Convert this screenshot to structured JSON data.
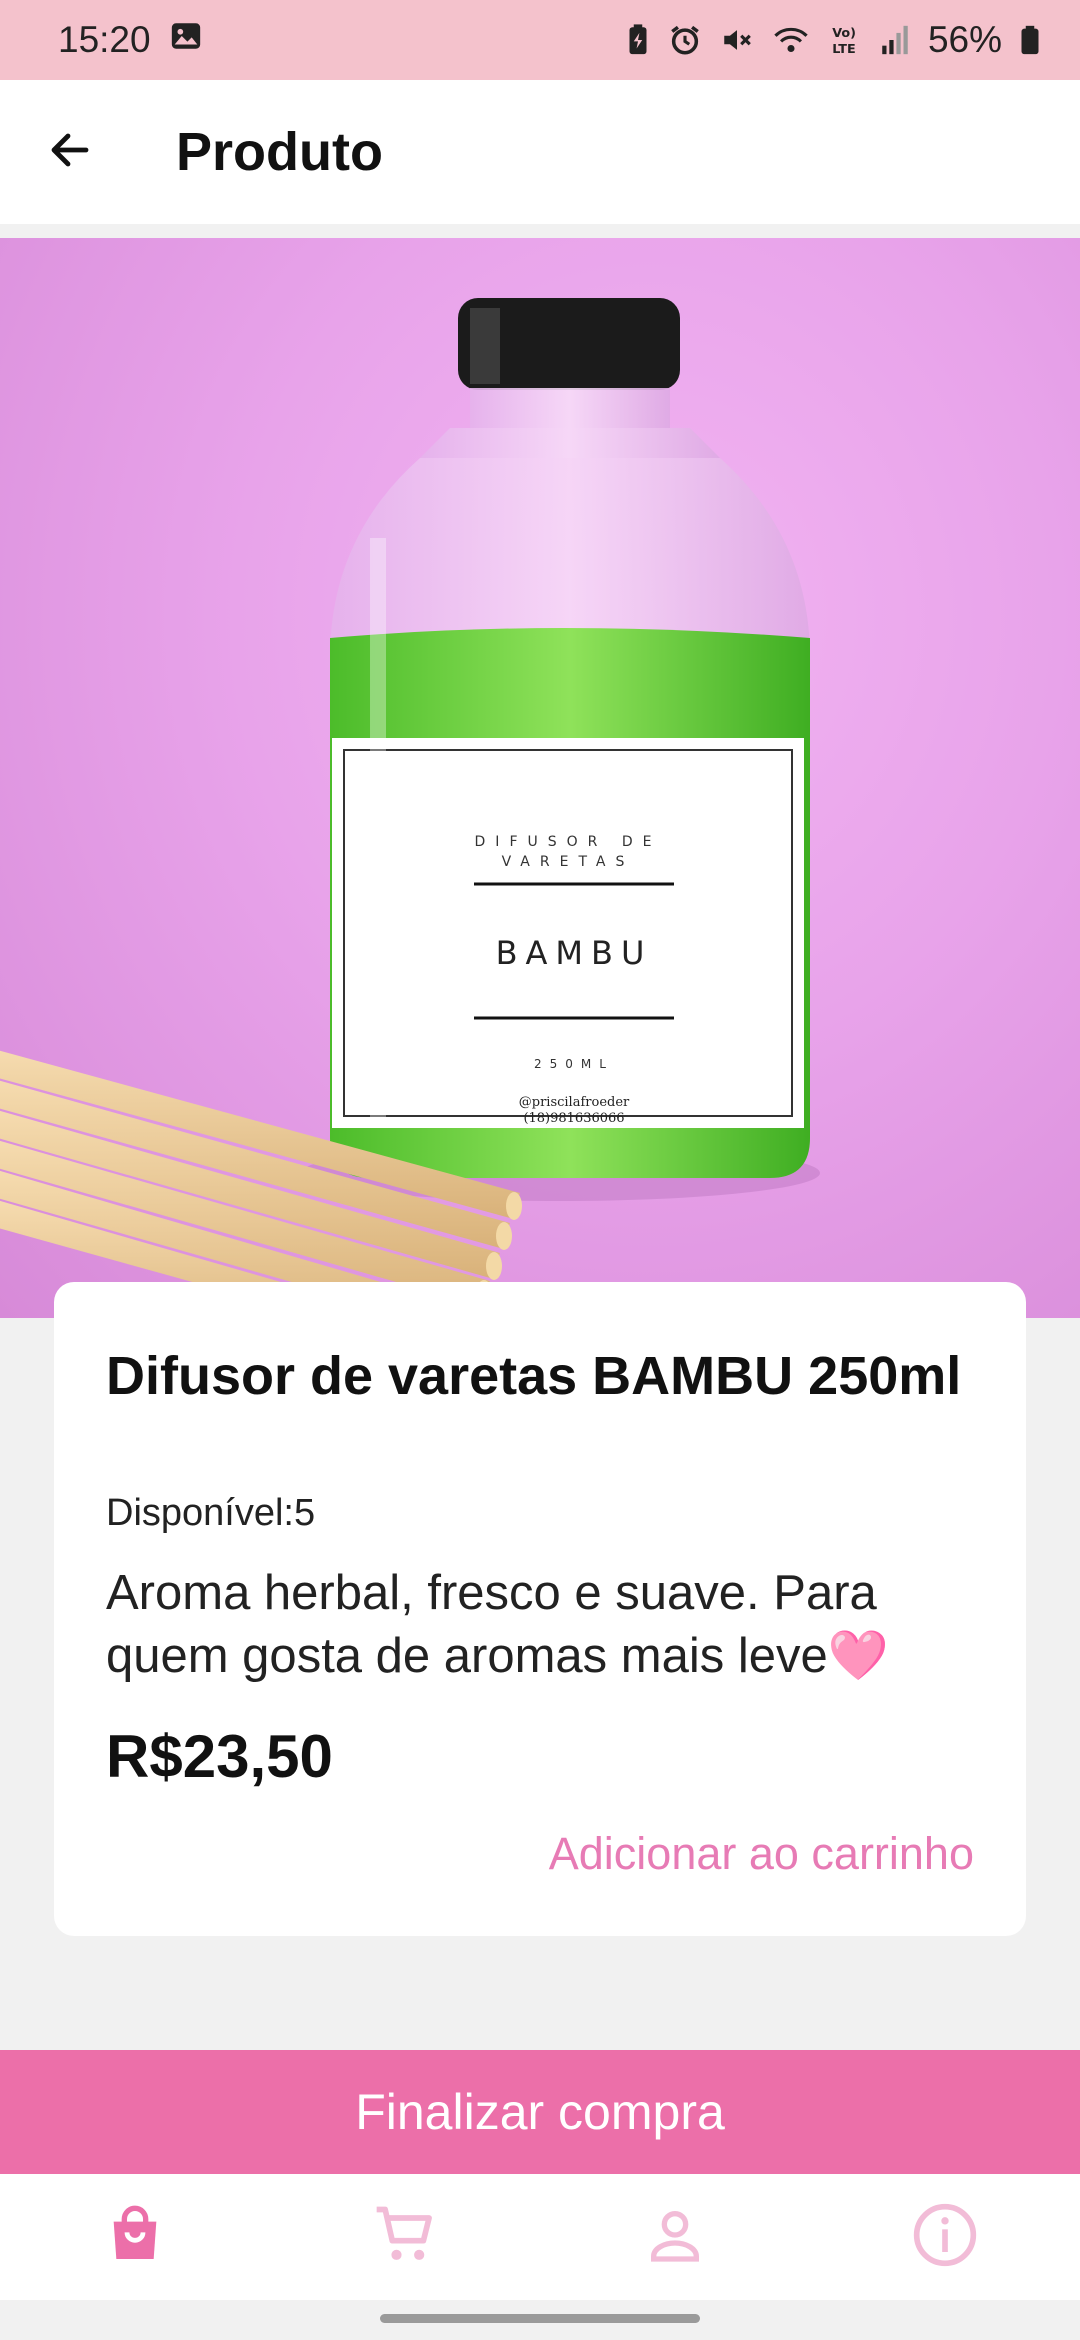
{
  "status_bar": {
    "time": "15:20",
    "battery": "56%",
    "icons": [
      "image-icon",
      "battery-saver-icon",
      "alarm-icon",
      "mute-icon",
      "wifi-icon",
      "volte-icon",
      "signal-icon",
      "battery-icon"
    ]
  },
  "app_bar": {
    "title": "Produto",
    "back_icon": "arrow-left-icon"
  },
  "product": {
    "image_label": {
      "line1": "DIFUSOR DE",
      "line2": "VARETAS",
      "name": "BAMBU",
      "volume": "250ML",
      "handle": "@priscilafroeder",
      "phone": "(18)981636066"
    },
    "name": "Difusor de varetas BAMBU 250ml",
    "stock": "Disponível:5",
    "description": "Aroma herbal, fresco e suave. Para quem gosta de aromas mais leve🩷",
    "price": "R$23,50",
    "add_to_cart": "Adicionar ao carrinho"
  },
  "checkout_button": "Finalizar compra",
  "bottom_nav": {
    "items": [
      {
        "icon": "shopping-bag-icon",
        "active": true
      },
      {
        "icon": "cart-icon",
        "active": false
      },
      {
        "icon": "user-icon",
        "active": false
      },
      {
        "icon": "info-icon",
        "active": false
      }
    ]
  },
  "colors": {
    "status_bar": "#f4c2cc",
    "accent": "#ec6fa9",
    "accent_light": "#f2bcd7",
    "link": "#e77bb5"
  }
}
